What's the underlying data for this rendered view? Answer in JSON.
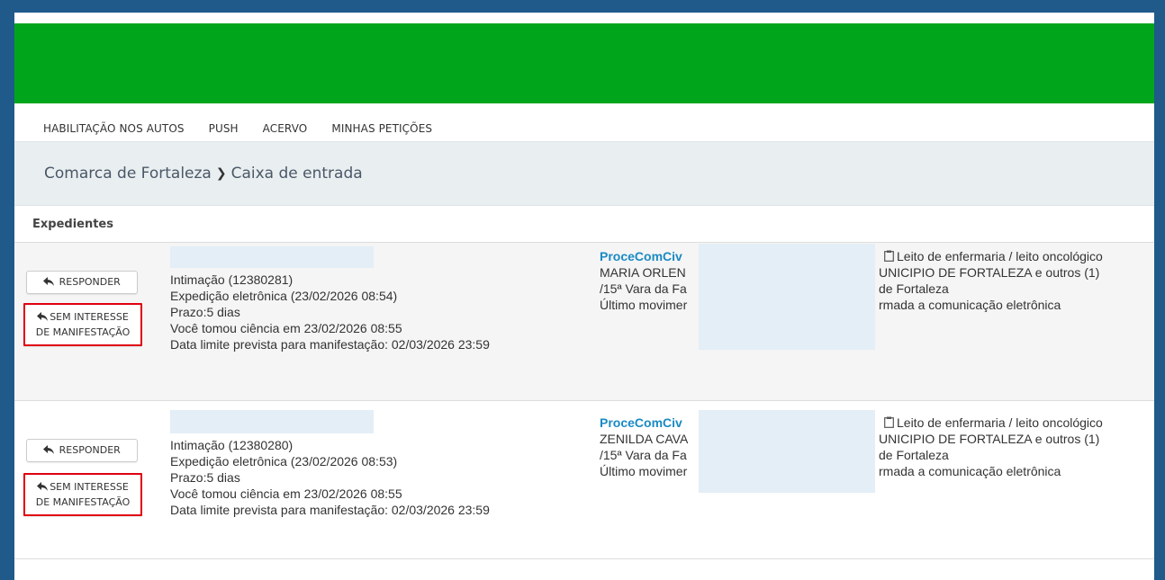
{
  "nav": {
    "items": [
      "HABILITAÇÃO NOS AUTOS",
      "PUSH",
      "ACERVO",
      "MINHAS PETIÇÕES"
    ]
  },
  "breadcrumb": {
    "parent": "Comarca de Fortaleza",
    "current": "Caixa de entrada"
  },
  "section": {
    "title": "Expedientes"
  },
  "buttons": {
    "respond": "RESPONDER",
    "sem_line1": "SEM INTERESSE",
    "sem_line2": "DE MANIFESTAÇÃO"
  },
  "expedientes": [
    {
      "intimacao": "Intimação (12380281)",
      "expedicao": "Expedição eletrônica (23/02/2026 08:54)",
      "prazo": "Prazo:5 dias",
      "ciencia": "Você tomou ciência em 23/02/2026 08:55",
      "limite": "Data limite prevista para manifestação: 02/03/2026 23:59",
      "proc_link": "ProceComCiv",
      "party_left": "MARIA ORLEN",
      "vara_left": "/15ª Vara da Fa",
      "mov_left": "Último movimer",
      "tag": "Leito de enfermaria / leito oncológico",
      "party_right": "UNICIPIO DE FORTALEZA e outros (1)",
      "vara_right": "de Fortaleza",
      "mov_right": "rmada a comunicação eletrônica"
    },
    {
      "intimacao": "Intimação (12380280)",
      "expedicao": "Expedição eletrônica (23/02/2026 08:53)",
      "prazo": "Prazo:5 dias",
      "ciencia": "Você tomou ciência em 23/02/2026 08:55",
      "limite": "Data limite prevista para manifestação: 02/03/2026 23:59",
      "proc_link": "ProceComCiv",
      "party_left": "ZENILDA CAVA",
      "vara_left": "/15ª Vara da Fa",
      "mov_left": "Último movimer",
      "tag": "Leito de enfermaria / leito oncológico",
      "party_right": "UNICIPIO DE FORTALEZA e outros (1)",
      "vara_right": "de Fortaleza",
      "mov_right": "rmada a comunicação eletrônica"
    }
  ],
  "icons": {
    "reply": "reply-arrow-icon",
    "clipboard": "clipboard-icon"
  },
  "colors": {
    "banner": "#00a51c",
    "frame": "#1f5a8a",
    "link": "#1a8ac4",
    "highlight": "#e0000f"
  }
}
